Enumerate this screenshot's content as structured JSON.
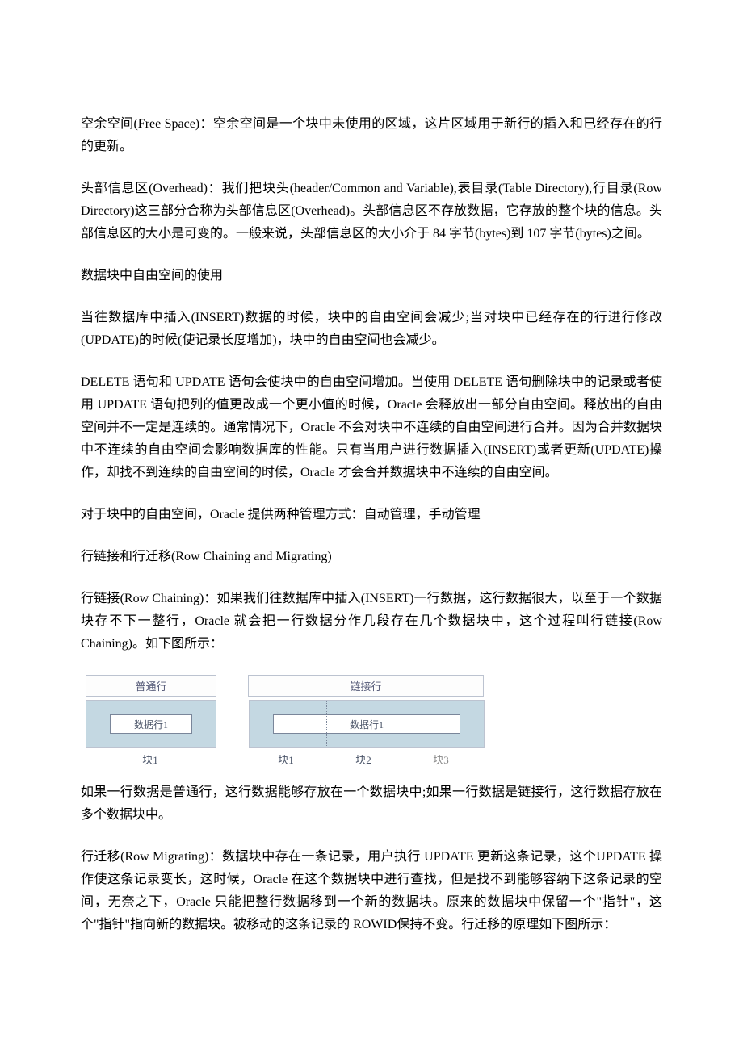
{
  "paragraphs": {
    "p1": "空余空间(Free Space)：空余空间是一个块中未使用的区域，这片区域用于新行的插入和已经存在的行的更新。",
    "p2": "头部信息区(Overhead)：我们把块头(header/Common and Variable),表目录(Table Directory),行目录(Row Directory)这三部分合称为头部信息区(Overhead)。头部信息区不存放数据，它存放的整个块的信息。头部信息区的大小是可变的。一般来说，头部信息区的大小介于 84 字节(bytes)到 107 字节(bytes)之间。",
    "p3": "数据块中自由空间的使用",
    "p4": "当往数据库中插入(INSERT)数据的时候，块中的自由空间会减少;当对块中已经存在的行进行修改(UPDATE)的时候(使记录长度增加)，块中的自由空间也会减少。",
    "p5": "DELETE 语句和 UPDATE 语句会使块中的自由空间增加。当使用 DELETE 语句删除块中的记录或者使用 UPDATE 语句把列的值更改成一个更小值的时候，Oracle 会释放出一部分自由空间。释放出的自由空间并不一定是连续的。通常情况下，Oracle 不会对块中不连续的自由空间进行合并。因为合并数据块中不连续的自由空间会影响数据库的性能。只有当用户进行数据插入(INSERT)或者更新(UPDATE)操作，却找不到连续的自由空间的时候，Oracle 才会合并数据块中不连续的自由空间。",
    "p6": "对于块中的自由空间，Oracle 提供两种管理方式：自动管理，手动管理",
    "p7": "行链接和行迁移(Row Chaining and Migrating)",
    "p8": "行链接(Row Chaining)：如果我们往数据库中插入(INSERT)一行数据，这行数据很大，以至于一个数据块存不下一整行，Oracle 就会把一行数据分作几段存在几个数据块中，这个过程叫行链接(Row Chaining)。如下图所示：",
    "p9": "如果一行数据是普通行，这行数据能够存放在一个数据块中;如果一行数据是链接行，这行数据存放在多个数据块中。",
    "p10": "行迁移(Row Migrating)：数据块中存在一条记录，用户执行 UPDATE 更新这条记录，这个UPDATE 操作使这条记录变长，这时候，Oracle 在这个数据块中进行查找，但是找不到能够容纳下这条记录的空间，无奈之下，Oracle 只能把整行数据移到一个新的数据块。原来的数据块中保留一个\"指针\"，这个\"指针\"指向新的数据块。被移动的这条记录的 ROWID保持不变。行迁移的原理如下图所示："
  },
  "diagram": {
    "header_left": "普通行",
    "header_right": "链接行",
    "row_left": "数据行1",
    "row_right": "数据行1",
    "label_block1_left": "块1",
    "label_block1_right": "块1",
    "label_block2": "块2",
    "label_block3": "块3"
  }
}
